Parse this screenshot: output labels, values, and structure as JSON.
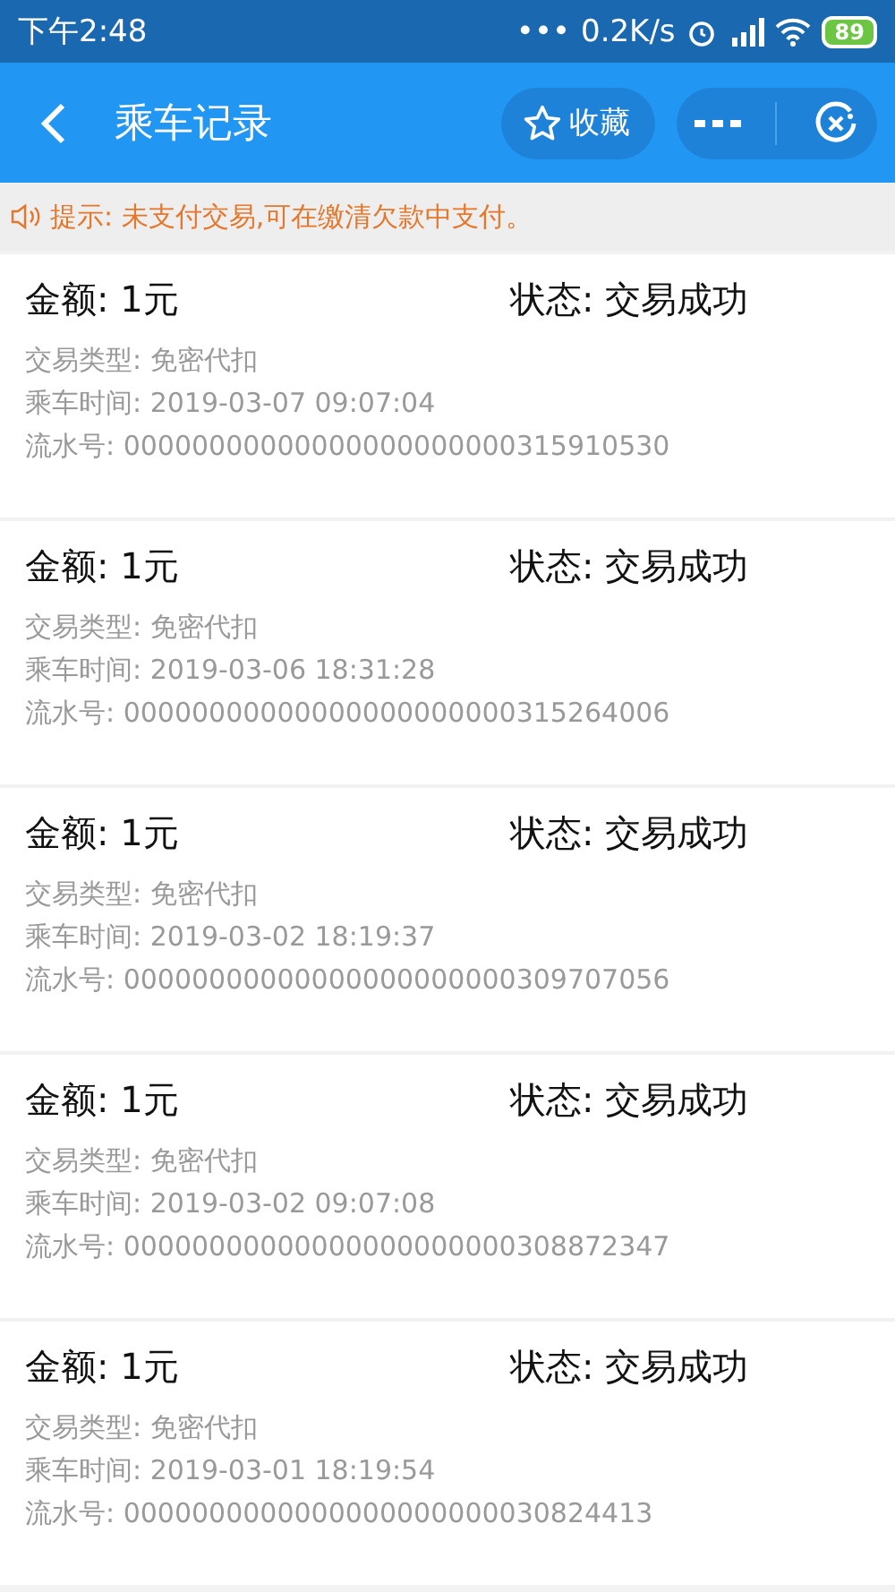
{
  "status_bar": {
    "time": "下午2:48",
    "dots": "•••",
    "speed": "0.2K/s",
    "battery": "89"
  },
  "nav": {
    "title": "乘车记录",
    "favorite": "收藏"
  },
  "notice": "提示: 未支付交易,可在缴清欠款中支付。",
  "records": [
    {
      "amount": "金额: 1元",
      "status": "状态: 交易成功",
      "type": "交易类型: 免密代扣",
      "time": "乘车时间: 2019-03-07 09:07:04",
      "serial": "流水号: 00000000000000000000000315910530"
    },
    {
      "amount": "金额: 1元",
      "status": "状态: 交易成功",
      "type": "交易类型: 免密代扣",
      "time": "乘车时间: 2019-03-06 18:31:28",
      "serial": "流水号: 00000000000000000000000315264006"
    },
    {
      "amount": "金额: 1元",
      "status": "状态: 交易成功",
      "type": "交易类型: 免密代扣",
      "time": "乘车时间: 2019-03-02 18:19:37",
      "serial": "流水号: 00000000000000000000000309707056"
    },
    {
      "amount": "金额: 1元",
      "status": "状态: 交易成功",
      "type": "交易类型: 免密代扣",
      "time": "乘车时间: 2019-03-02 09:07:08",
      "serial": "流水号: 00000000000000000000000308872347"
    },
    {
      "amount": "金额: 1元",
      "status": "状态: 交易成功",
      "type": "交易类型: 免密代扣",
      "time": "乘车时间: 2019-03-01 18:19:54",
      "serial": "流水号: 0000000000000000000000030824413"
    }
  ]
}
